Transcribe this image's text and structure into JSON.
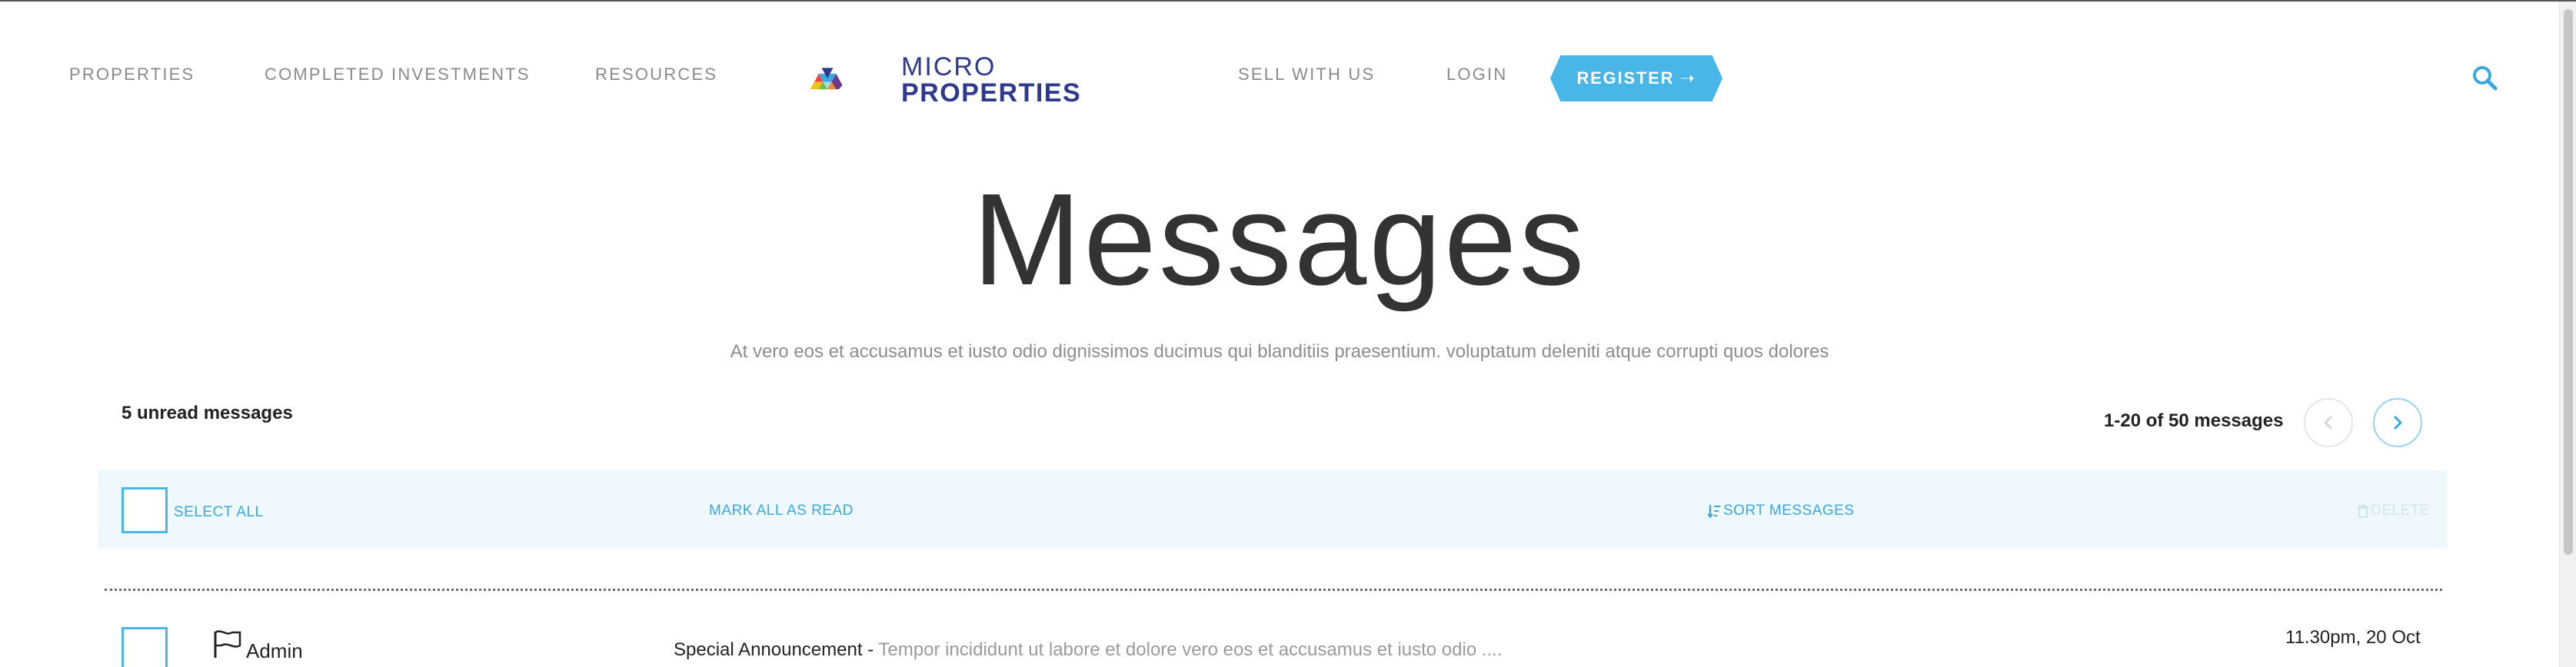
{
  "nav": {
    "left": [
      "PROPERTIES",
      "COMPLETED INVESTMENTS",
      "RESOURCES"
    ],
    "right": [
      "SELL WITH US",
      "LOGIN"
    ],
    "register_label": "REGISTER ➝"
  },
  "logo": {
    "line1": "MICRO",
    "line2": "PROPERTIES"
  },
  "page": {
    "title": "Messages",
    "subtitle": "At vero eos et accusamus et iusto odio dignissimos ducimus qui blanditiis praesentium. voluptatum deleniti atque corrupti quos dolores"
  },
  "summary": {
    "unread": "5 unread messages",
    "range": "1-20 of 50 messages"
  },
  "toolbar": {
    "select_all": "SELECT ALL",
    "mark_all_read": "MARK ALL AS READ",
    "sort": "SORT MESSAGES",
    "delete": "DELETE"
  },
  "messages": [
    {
      "sender": "Admin",
      "subject": "Special Announcement - ",
      "preview": "Tempor incididunt ut labore et dolore vero eos et accusamus et iusto odio ....",
      "time": "11.30pm, 20 Oct"
    }
  ],
  "colors": {
    "accent": "#49b6e8",
    "toolbar_bg": "#eef8fd",
    "brand_navy": "#2e3a8c"
  },
  "icons": [
    "search-icon",
    "chevron-left-icon",
    "chevron-right-icon",
    "sort-icon",
    "trash-icon",
    "flag-icon"
  ]
}
